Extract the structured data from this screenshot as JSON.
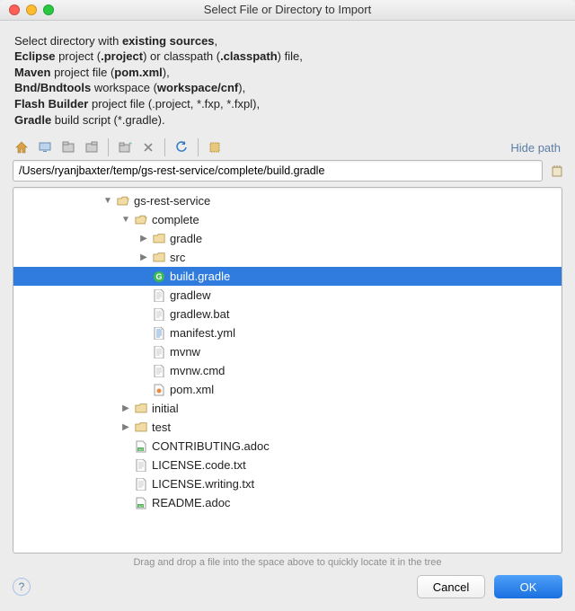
{
  "window": {
    "title": "Select File or Directory to Import"
  },
  "instructions": {
    "l1a": "Select directory with ",
    "l1b": "existing sources",
    "l1c": ",",
    "l2a": "Eclipse",
    "l2b": " project (",
    "l2c": ".project",
    "l2d": ") or classpath (",
    "l2e": ".classpath",
    "l2f": ") file,",
    "l3a": "Maven",
    "l3b": " project file (",
    "l3c": "pom.xml",
    "l3d": "),",
    "l4a": "Bnd/Bndtools",
    "l4b": " workspace (",
    "l4c": "workspace/cnf",
    "l4d": "),",
    "l5a": "Flash Builder",
    "l5b": " project file (.project, *.fxp, *.fxpl),",
    "l6a": "Gradle",
    "l6b": " build script (*.gradle)."
  },
  "links": {
    "hide_path": "Hide path"
  },
  "path": {
    "value": "/Users/ryanjbaxter/temp/gs-rest-service/complete/build.gradle"
  },
  "tree": {
    "n0": {
      "label": "gs-rest-service"
    },
    "n1": {
      "label": "complete"
    },
    "n2": {
      "label": "gradle"
    },
    "n3": {
      "label": "src"
    },
    "n4": {
      "label": "build.gradle"
    },
    "n5": {
      "label": "gradlew"
    },
    "n6": {
      "label": "gradlew.bat"
    },
    "n7": {
      "label": "manifest.yml"
    },
    "n8": {
      "label": "mvnw"
    },
    "n9": {
      "label": "mvnw.cmd"
    },
    "n10": {
      "label": "pom.xml"
    },
    "n11": {
      "label": "initial"
    },
    "n12": {
      "label": "test"
    },
    "n13": {
      "label": "CONTRIBUTING.adoc"
    },
    "n14": {
      "label": "LICENSE.code.txt"
    },
    "n15": {
      "label": "LICENSE.writing.txt"
    },
    "n16": {
      "label": "README.adoc"
    }
  },
  "hint": "Drag and drop a file into the space above to quickly locate it in the tree",
  "buttons": {
    "cancel": "Cancel",
    "ok": "OK"
  }
}
